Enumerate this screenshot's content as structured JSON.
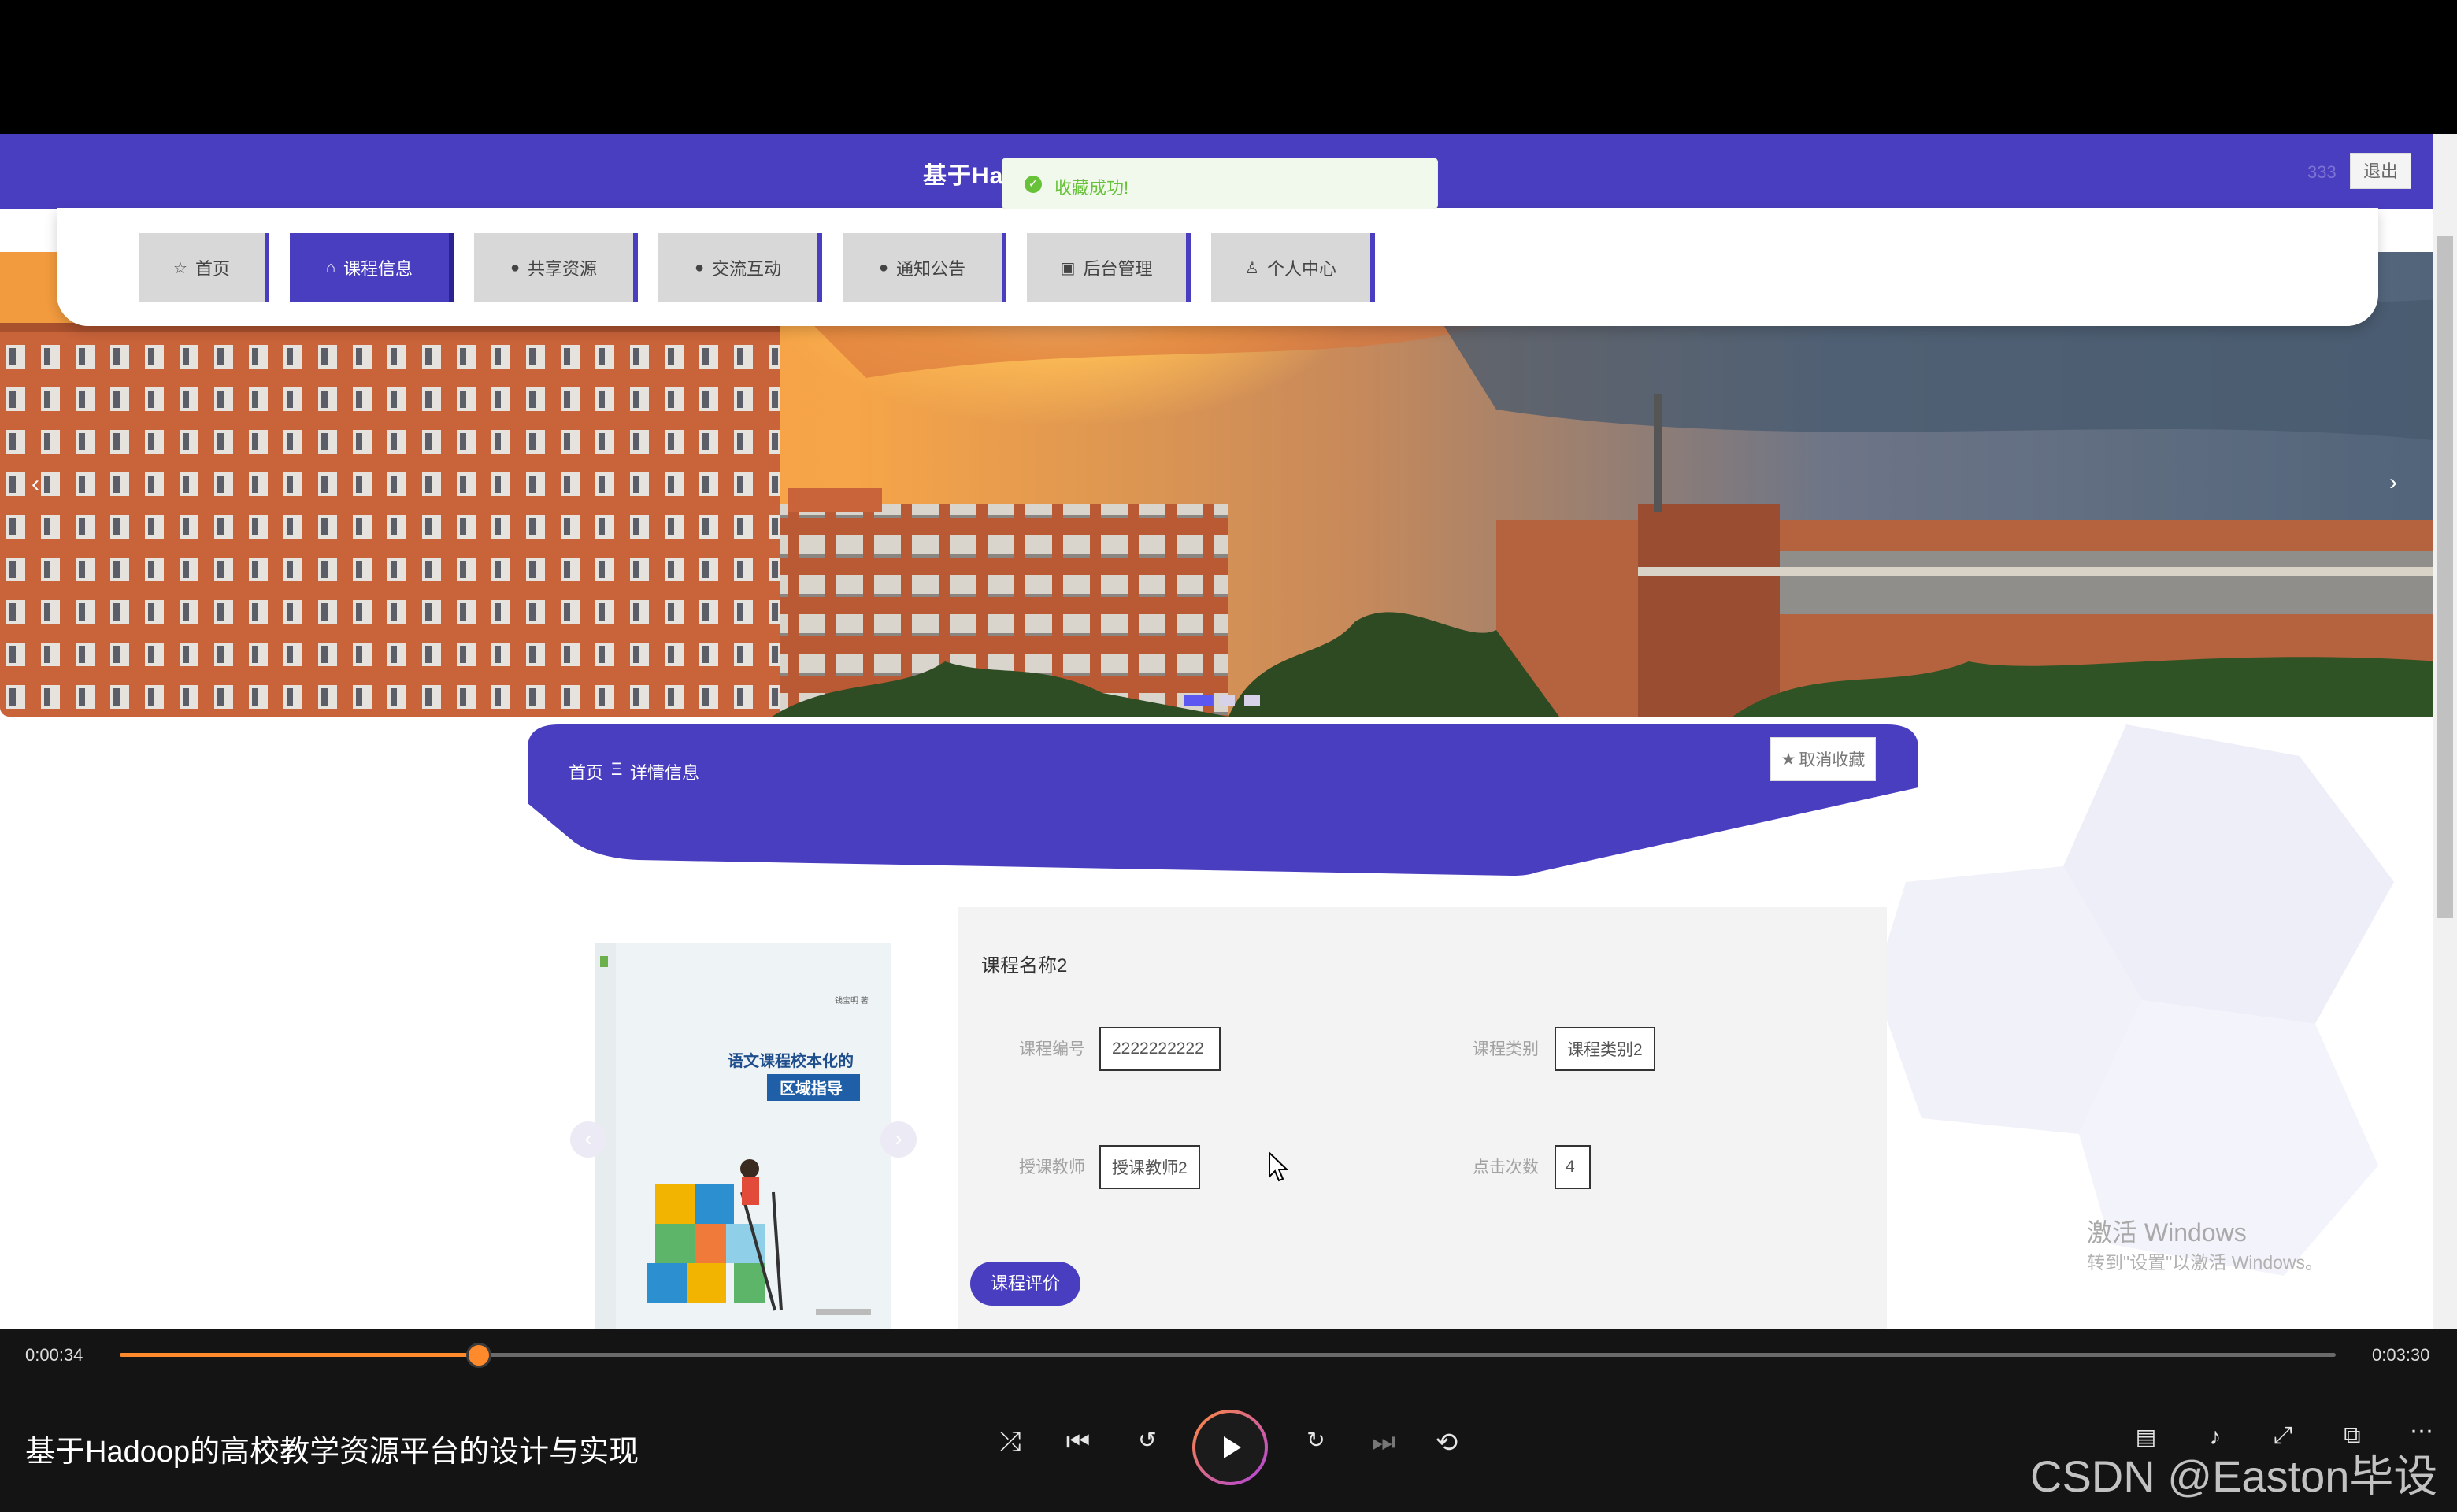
{
  "site": {
    "title": "基于Ha",
    "user": "333",
    "logout": "退出"
  },
  "toast": {
    "text": "收藏成功!"
  },
  "nav": [
    {
      "label": "首页",
      "icon": "star-icon"
    },
    {
      "label": "课程信息",
      "icon": "bag-icon",
      "active": true
    },
    {
      "label": "共享资源",
      "icon": "alert-icon"
    },
    {
      "label": "交流互动",
      "icon": "question-icon"
    },
    {
      "label": "通知公告",
      "icon": "info-icon"
    },
    {
      "label": "后台管理",
      "icon": "calendar-icon"
    },
    {
      "label": "个人中心",
      "icon": "user-icon"
    }
  ],
  "banner": {
    "slide_count": 3,
    "active_index": 0,
    "prev": "‹",
    "next": "›"
  },
  "breadcrumb": {
    "home": "首页",
    "separator": "Ξ",
    "current": "详情信息"
  },
  "uncollect": "取消收藏",
  "book": {
    "author": "钱宝明  著",
    "title_line1": "语文课程校本化的",
    "title_line2": "区域指导",
    "spine": "语文课程校本化的区域指导"
  },
  "course": {
    "name": "课程名称2",
    "fields": [
      {
        "label": "课程编号",
        "value": "2222222222"
      },
      {
        "label": "课程类别",
        "value": "课程类别2"
      },
      {
        "label": "授课教师",
        "value": "授课教师2"
      },
      {
        "label": "点击次数",
        "value": "4"
      }
    ],
    "review_button": "课程评价"
  },
  "watermark": {
    "title": "激活 Windows",
    "sub": "转到\"设置\"以激活 Windows。"
  },
  "player": {
    "current": "0:00:34",
    "total": "0:03:30",
    "progress": 0.162,
    "title": "基于Hadoop的高校教学资源平台的设计与实现",
    "brand": "CSDN @Easton毕设"
  },
  "colors": {
    "header": "#4a3ec0",
    "accent_progress": "#ff8a2b",
    "toast_green": "#67c23a"
  }
}
